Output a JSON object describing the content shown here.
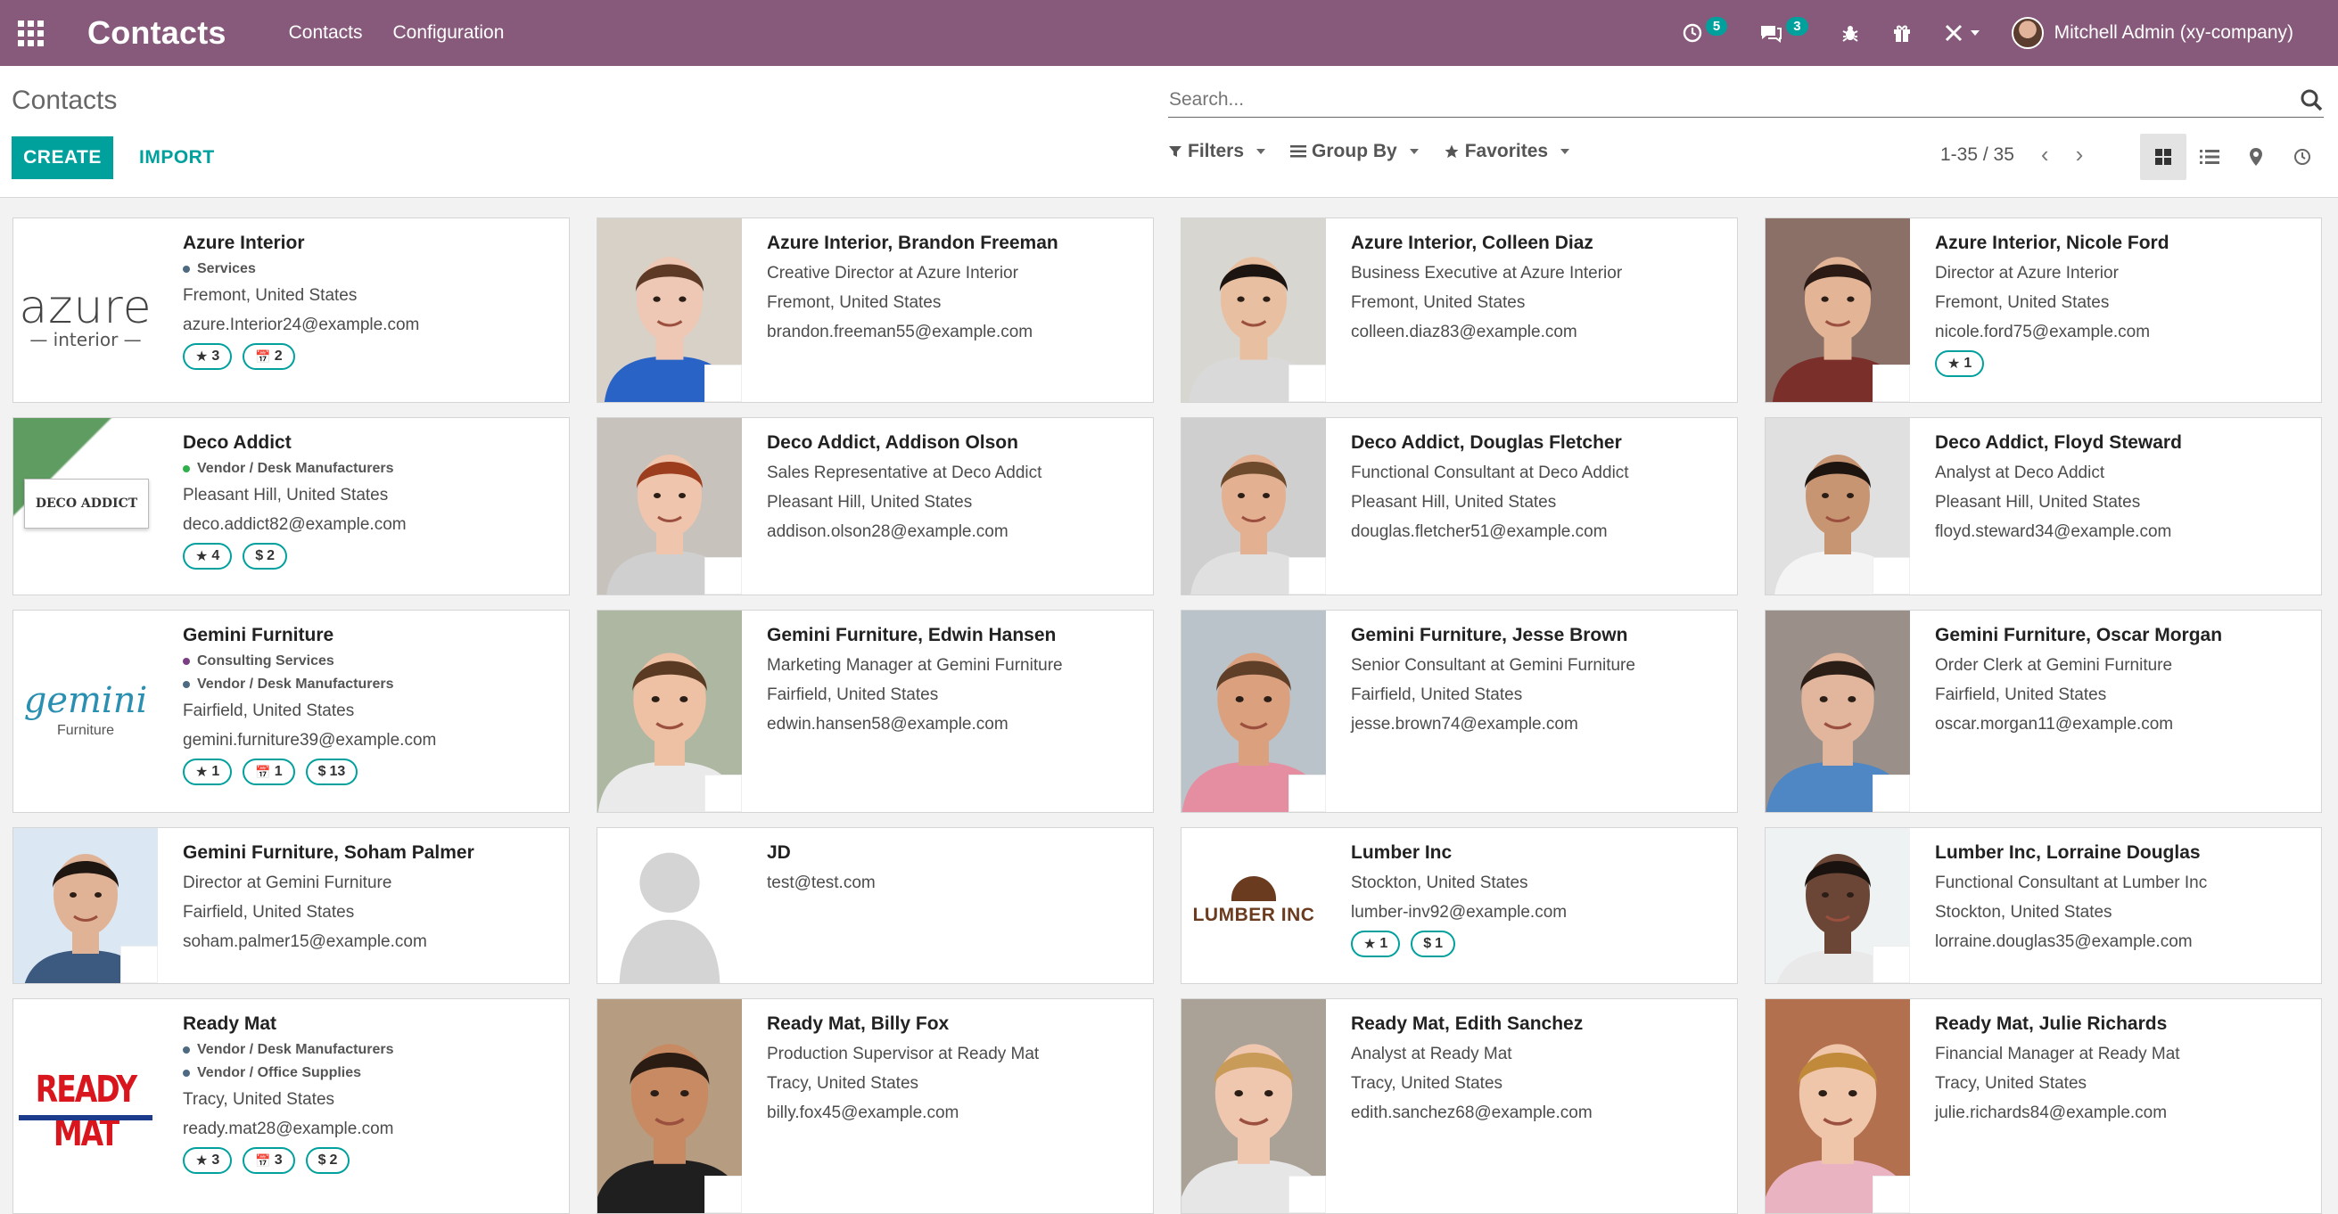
{
  "navbar": {
    "brand": "Contacts",
    "menu": [
      "Contacts",
      "Configuration"
    ],
    "activity_count": "5",
    "messages_count": "3",
    "user_name": "Mitchell Admin (xy-company)"
  },
  "control_panel": {
    "breadcrumb": "Contacts",
    "create_label": "CREATE",
    "import_label": "IMPORT",
    "search_placeholder": "Search...",
    "filters_label": "Filters",
    "groupby_label": "Group By",
    "favorites_label": "Favorites",
    "pager": "1-35 / 35"
  },
  "cards": [
    {
      "name": "Azure Interior",
      "tags": [
        {
          "label": "Services",
          "color": "#4d6a82"
        }
      ],
      "lines": [
        "Fremont, United States",
        "azure.Interior24@example.com"
      ],
      "chips": [
        {
          "icon": "★",
          "v": "3"
        },
        {
          "icon": "📅",
          "v": "2"
        }
      ],
      "image": "logo-azure",
      "logo_text": "azure",
      "logo_sub": "— interior —"
    },
    {
      "name": "Azure Interior, Brandon Freeman",
      "tags": [],
      "lines": [
        "Creative Director at Azure Interior",
        "Fremont, United States",
        "brandon.freeman55@example.com"
      ],
      "chips": [],
      "image": "person",
      "skin": "#efc7b5",
      "hair": "#5c3a26",
      "bg": "#d7d1c7",
      "shirt": "#2a63c6"
    },
    {
      "name": "Azure Interior, Colleen Diaz",
      "tags": [],
      "lines": [
        "Business Executive at Azure Interior",
        "Fremont, United States",
        "colleen.diaz83@example.com"
      ],
      "chips": [],
      "image": "person",
      "skin": "#e9bfa1",
      "hair": "#1c1410",
      "bg": "#d8d6d0",
      "shirt": "#d9d9d9"
    },
    {
      "name": "Azure Interior, Nicole Ford",
      "tags": [],
      "lines": [
        "Director at Azure Interior",
        "Fremont, United States",
        "nicole.ford75@example.com"
      ],
      "chips": [
        {
          "icon": "★",
          "v": "1"
        }
      ],
      "image": "person",
      "skin": "#e3b596",
      "hair": "#2b1b14",
      "bg": "#8a7067",
      "shirt": "#7a2f2a"
    },
    {
      "name": "Deco Addict",
      "tags": [
        {
          "label": "Vendor / Desk Manufacturers",
          "color": "#2fb04a"
        }
      ],
      "lines": [
        "Pleasant Hill, United States",
        "deco.addict82@example.com"
      ],
      "chips": [
        {
          "icon": "★",
          "v": "4"
        },
        {
          "icon": "$",
          "v": "2"
        }
      ],
      "image": "logo-deco",
      "logo_text": "DECO ADDICT"
    },
    {
      "name": "Deco Addict, Addison Olson",
      "tags": [],
      "lines": [
        "Sales Representative at Deco Addict",
        "Pleasant Hill, United States",
        "addison.olson28@example.com"
      ],
      "chips": [],
      "image": "person",
      "skin": "#f0c5ad",
      "hair": "#9c3d1e",
      "bg": "#c8c2bd",
      "shirt": "#cfcfcf"
    },
    {
      "name": "Deco Addict, Douglas Fletcher",
      "tags": [],
      "lines": [
        "Functional Consultant at Deco Addict",
        "Pleasant Hill, United States",
        "douglas.fletcher51@example.com"
      ],
      "chips": [],
      "image": "person",
      "skin": "#e4b092",
      "hair": "#6e4a2c",
      "bg": "#cfcfcf",
      "shirt": "#e0e0e0"
    },
    {
      "name": "Deco Addict, Floyd Steward",
      "tags": [],
      "lines": [
        "Analyst at Deco Addict",
        "Pleasant Hill, United States",
        "floyd.steward34@example.com"
      ],
      "chips": [],
      "image": "person",
      "skin": "#c89573",
      "hair": "#1d1410",
      "bg": "#e0e0e0",
      "shirt": "#f4f4f4"
    },
    {
      "name": "Gemini Furniture",
      "tags": [
        {
          "label": "Consulting Services",
          "color": "#7a3f83"
        },
        {
          "label": "Vendor / Desk Manufacturers",
          "color": "#4d6a82"
        }
      ],
      "lines": [
        "Fairfield, United States",
        "gemini.furniture39@example.com"
      ],
      "chips": [
        {
          "icon": "★",
          "v": "1"
        },
        {
          "icon": "📅",
          "v": "1"
        },
        {
          "icon": "$",
          "v": "13"
        }
      ],
      "image": "logo-gemini",
      "logo_text": "gemini",
      "logo_sub": "Furniture"
    },
    {
      "name": "Gemini Furniture, Edwin Hansen",
      "tags": [],
      "lines": [
        "Marketing Manager at Gemini Furniture",
        "Fairfield, United States",
        "edwin.hansen58@example.com"
      ],
      "chips": [],
      "image": "person",
      "skin": "#eec0a4",
      "hair": "#5a3a22",
      "bg": "#aeb7a2",
      "shirt": "#eaeaea"
    },
    {
      "name": "Gemini Furniture, Jesse Brown",
      "tags": [],
      "lines": [
        "Senior Consultant at Gemini Furniture",
        "Fairfield, United States",
        "jesse.brown74@example.com"
      ],
      "chips": [],
      "image": "person",
      "skin": "#dba07e",
      "hair": "#5f3f28",
      "bg": "#b9c3c9",
      "shirt": "#e58ea2"
    },
    {
      "name": "Gemini Furniture, Oscar Morgan",
      "tags": [],
      "lines": [
        "Order Clerk at Gemini Furniture",
        "Fairfield, United States",
        "oscar.morgan11@example.com"
      ],
      "chips": [],
      "image": "person",
      "skin": "#e2b59d",
      "hair": "#2a1e17",
      "bg": "#9a9089",
      "shirt": "#4f86c4"
    },
    {
      "name": "Gemini Furniture, Soham Palmer",
      "tags": [],
      "lines": [
        "Director at Gemini Furniture",
        "Fairfield, United States",
        "soham.palmer15@example.com"
      ],
      "chips": [],
      "image": "person",
      "skin": "#e1b396",
      "hair": "#1f1612",
      "bg": "#dbe7f3",
      "shirt": "#3c5a80"
    },
    {
      "name": "JD",
      "tags": [],
      "lines": [
        "test@test.com"
      ],
      "chips": [],
      "image": "placeholder"
    },
    {
      "name": "Lumber Inc",
      "tags": [],
      "lines": [
        "Stockton, United States",
        "lumber-inv92@example.com"
      ],
      "chips": [
        {
          "icon": "★",
          "v": "1"
        },
        {
          "icon": "$",
          "v": "1"
        }
      ],
      "image": "logo-lumber",
      "logo_text": "LUMBER INC"
    },
    {
      "name": "Lumber Inc, Lorraine Douglas",
      "tags": [],
      "lines": [
        "Functional Consultant at Lumber Inc",
        "Stockton, United States",
        "lorraine.douglas35@example.com"
      ],
      "chips": [],
      "image": "person",
      "skin": "#6b4636",
      "hair": "#1a120e",
      "bg": "#eef2f2",
      "shirt": "#e9e9e9"
    },
    {
      "name": "Ready Mat",
      "tags": [
        {
          "label": "Vendor / Desk Manufacturers",
          "color": "#4d6a82"
        },
        {
          "label": "Vendor / Office Supplies",
          "color": "#4d6a82"
        }
      ],
      "lines": [
        "Tracy, United States",
        "ready.mat28@example.com"
      ],
      "chips": [
        {
          "icon": "★",
          "v": "3"
        },
        {
          "icon": "📅",
          "v": "3"
        },
        {
          "icon": "$",
          "v": "2"
        }
      ],
      "image": "logo-ready",
      "logo_text": "READY MAT"
    },
    {
      "name": "Ready Mat, Billy Fox",
      "tags": [],
      "lines": [
        "Production Supervisor at Ready Mat",
        "Tracy, United States",
        "billy.fox45@example.com"
      ],
      "chips": [],
      "image": "person",
      "skin": "#c88a62",
      "hair": "#2a1b13",
      "bg": "#b69c80",
      "shirt": "#1f1f1f"
    },
    {
      "name": "Ready Mat, Edith Sanchez",
      "tags": [],
      "lines": [
        "Analyst at Ready Mat",
        "Tracy, United States",
        "edith.sanchez68@example.com"
      ],
      "chips": [],
      "image": "person",
      "skin": "#efc6ae",
      "hair": "#c89b58",
      "bg": "#aaa197",
      "shirt": "#e6e6e6"
    },
    {
      "name": "Ready Mat, Julie Richards",
      "tags": [],
      "lines": [
        "Financial Manager at Ready Mat",
        "Tracy, United States",
        "julie.richards84@example.com"
      ],
      "chips": [],
      "image": "person",
      "skin": "#efc6aa",
      "hair": "#c18a3a",
      "bg": "#b3704e",
      "shirt": "#e9b3c2"
    }
  ],
  "colors": {
    "navbar": "#875a7b",
    "accent": "#00a09d"
  }
}
